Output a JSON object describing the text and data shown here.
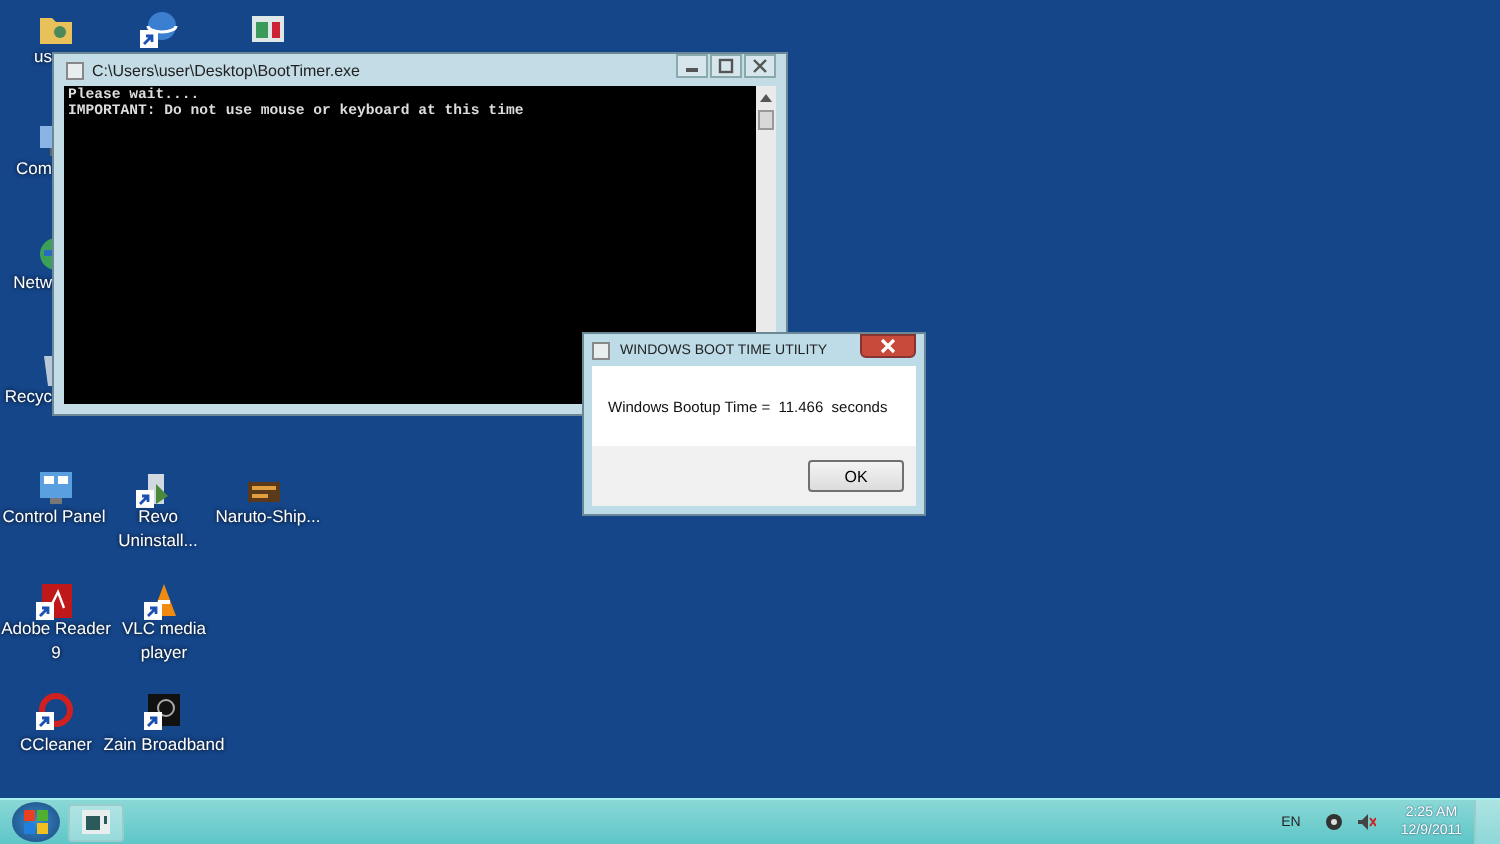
{
  "desktop_icons": [
    {
      "shortcut": false
    },
    {
      "shortcut": true
    },
    {
      "shortcut": false
    },
    {
      "label": "us"
    },
    {
      "label": "Com",
      "shortcut": false
    },
    {
      "label": "Netw",
      "shortcut": false
    },
    {
      "label": "Recyc",
      "shortcut": false
    },
    {
      "label": "Control Panel",
      "shortcut": false
    },
    {
      "label": "Revo Uninstall...",
      "shortcut": true
    },
    {
      "label": "Naruto-Ship...",
      "shortcut": false
    },
    {
      "label": "Adobe Reader 9",
      "shortcut": true
    },
    {
      "label": "VLC media player",
      "shortcut": true
    },
    {
      "label": "CCleaner",
      "shortcut": true
    },
    {
      "label": "Zain Broadband",
      "shortcut": true
    }
  ],
  "console_window": {
    "title": "C:\\Users\\user\\Desktop\\BootTimer.exe",
    "lines": [
      "Please wait....",
      "IMPORTANT: Do not use mouse or keyboard at this time"
    ]
  },
  "dialog": {
    "title": "WINDOWS BOOT TIME UTILITY",
    "message": "Windows Bootup Time =  11.466  seconds",
    "button": "OK"
  },
  "taskbar": {
    "language": "EN",
    "time": "2:25 AM",
    "date": "12/9/2011"
  }
}
